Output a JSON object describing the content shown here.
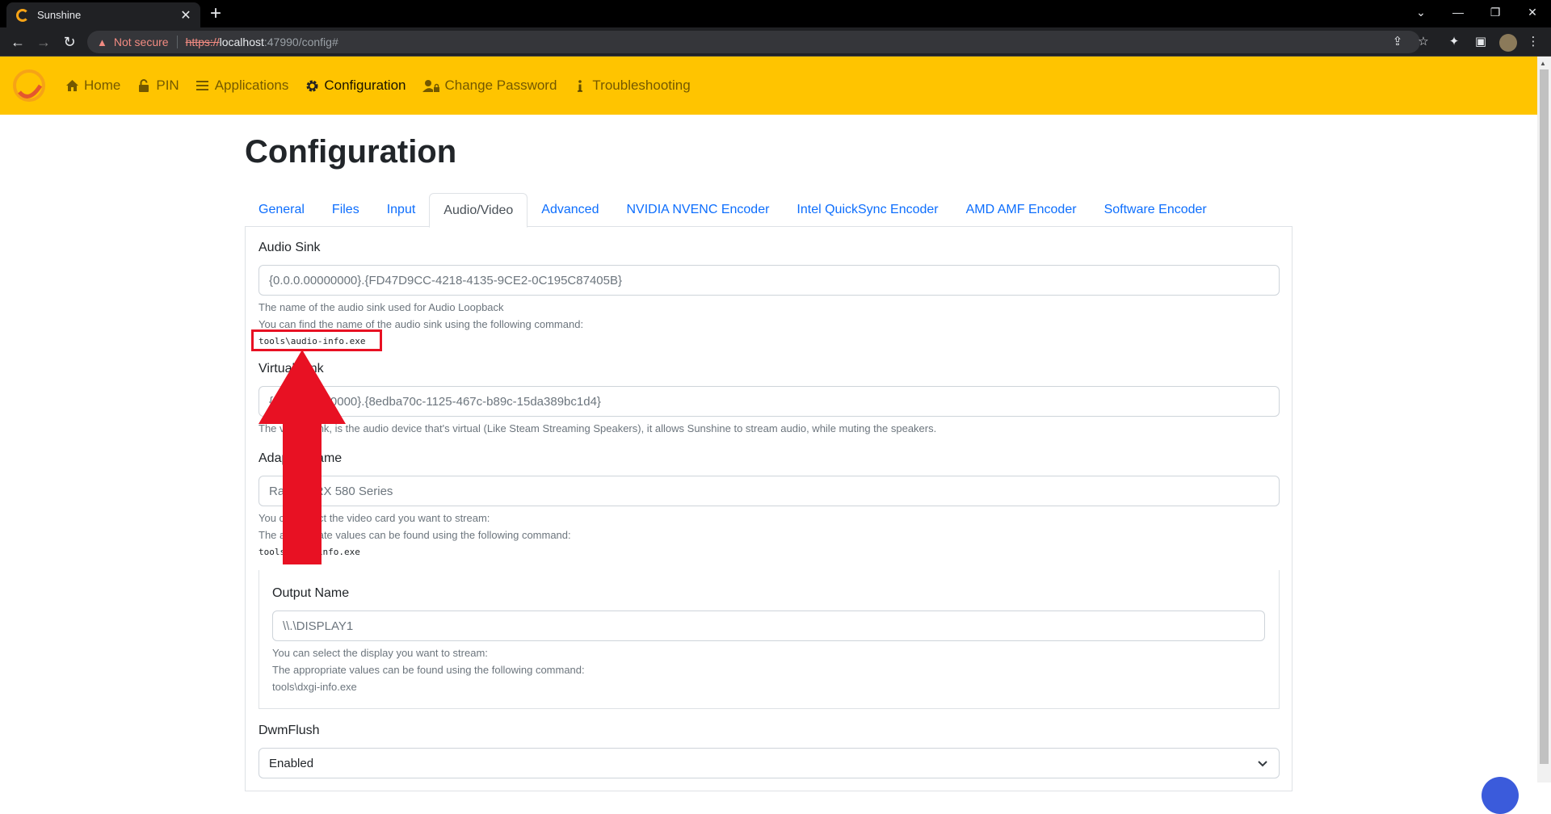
{
  "browser": {
    "tab_title": "Sunshine",
    "tab_close": "✕",
    "new_tab": "+",
    "security_label": "Not secure",
    "url_scheme": "https://",
    "url_host": "localhost",
    "url_rest": ":47990/config#"
  },
  "nav": {
    "items": [
      {
        "label": "Home",
        "icon": "home-icon"
      },
      {
        "label": "PIN",
        "icon": "lock-icon"
      },
      {
        "label": "Applications",
        "icon": "list-icon"
      },
      {
        "label": "Configuration",
        "icon": "gear-icon",
        "active": true
      },
      {
        "label": "Change Password",
        "icon": "user-lock-icon"
      },
      {
        "label": "Troubleshooting",
        "icon": "info-icon"
      }
    ]
  },
  "page": {
    "title": "Configuration",
    "tabs": [
      "General",
      "Files",
      "Input",
      "Audio/Video",
      "Advanced",
      "NVIDIA NVENC Encoder",
      "Intel QuickSync Encoder",
      "AMD AMF Encoder",
      "Software Encoder"
    ],
    "active_tab": "Audio/Video"
  },
  "form": {
    "audio_sink": {
      "label": "Audio Sink",
      "placeholder": "{0.0.0.00000000}.{FD47D9CC-4218-4135-9CE2-0C195C87405B}",
      "help1": "The name of the audio sink used for Audio Loopback",
      "help2": "You can find the name of the audio sink using the following command:",
      "command": "tools\\audio-info.exe"
    },
    "virtual_sink": {
      "label": "Virtual Sink",
      "placeholder": "{0.0.0.00000000}.{8edba70c-1125-467c-b89c-15da389bc1d4}",
      "help": "The virtual sink, is the audio device that's virtual (Like Steam Streaming Speakers), it allows Sunshine to stream audio, while muting the speakers."
    },
    "adapter_name": {
      "label": "Adapter Name",
      "placeholder": "Radeon RX 580 Series",
      "help1": "You can select the video card you want to stream:",
      "help2": "The appropriate values can be found using the following command:",
      "command": "tools\\dxgi-info.exe"
    },
    "output_name": {
      "label": "Output Name",
      "placeholder": "\\\\.\\DISPLAY1",
      "help1": "You can select the display you want to stream:",
      "help2": "The appropriate values can be found using the following command:",
      "command": "tools\\dxgi-info.exe"
    },
    "dwmflush": {
      "label": "DwmFlush",
      "value": "Enabled"
    }
  },
  "annotation": {
    "box_color": "#e81123",
    "arrow_color": "#e81123"
  }
}
